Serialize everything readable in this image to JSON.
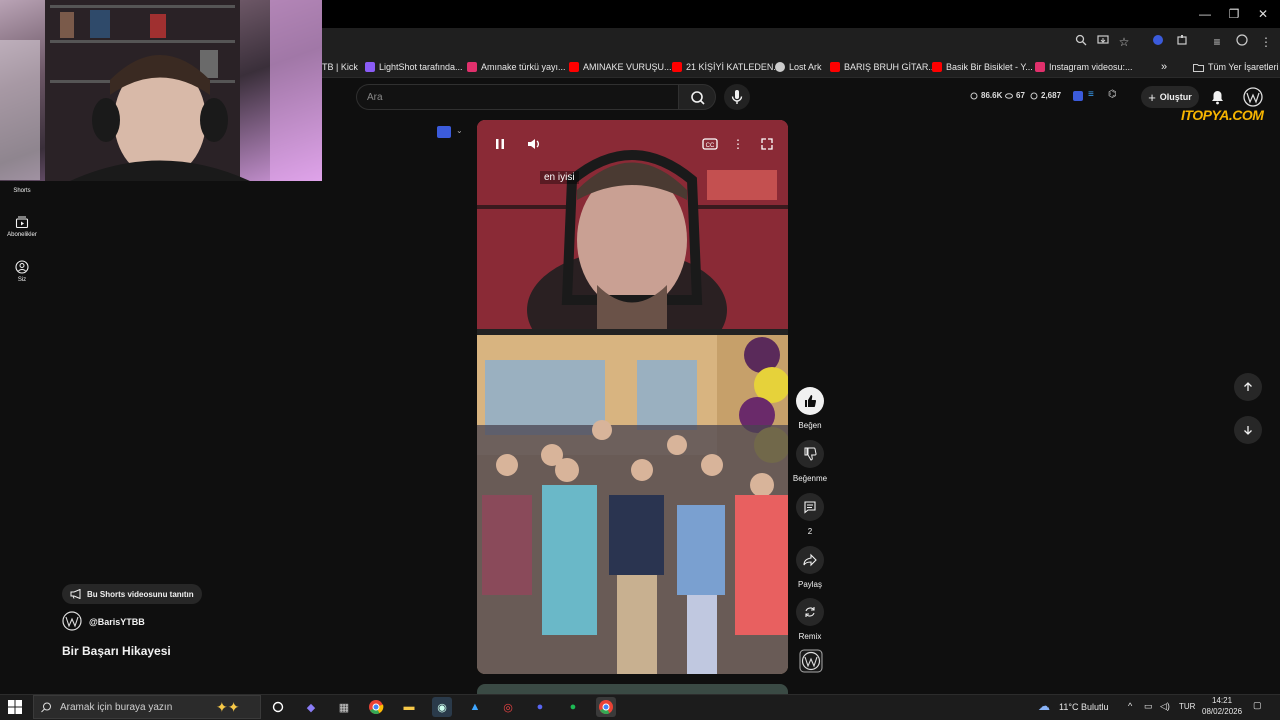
{
  "window": {
    "minimize": "—",
    "maximize": "❐",
    "close": "✕"
  },
  "bookmarks": [
    {
      "label": "TB | Kick",
      "color": "#53fc18"
    },
    {
      "label": "LightShot tarafında...",
      "color": "#8a5cf6"
    },
    {
      "label": "Amınake türkü yayı...",
      "color": "#e1306c"
    },
    {
      "label": "AMINAKE VURUŞU...",
      "color": "#ff0000"
    },
    {
      "label": "21 KİŞİYİ KATLEDEN...",
      "color": "#ff0000"
    },
    {
      "label": "Lost Ark",
      "color": "#cccccc"
    },
    {
      "label": "BARIŞ BRUH GİTAR...",
      "color": "#ff0000"
    },
    {
      "label": "Basik Bir Bisiklet - Y...",
      "color": "#ff0000"
    },
    {
      "label": "Instagram videosu:...",
      "color": "#e1306c"
    }
  ],
  "bookmarks_more": "»",
  "all_bookmarks": "Tüm Yer İşaretleri",
  "search": {
    "placeholder": "Ara"
  },
  "stats": {
    "views": "86.6K",
    "likes": "67",
    "other": "2,687"
  },
  "create_label": "Oluştur",
  "watermark": "ITOPYA.COM",
  "sidebar": [
    {
      "label": "Shorts"
    },
    {
      "label": "Abonelikler"
    },
    {
      "label": "Siz"
    }
  ],
  "video": {
    "caption": "en iyisi"
  },
  "actions": {
    "like": "Beğen",
    "dislike": "Beğenme",
    "comments": "2",
    "share": "Paylaş",
    "remix": "Remix"
  },
  "channel": {
    "promote": "Bu Shorts videosunu tanıtın",
    "handle": "@BarisYTBB",
    "title": "Bir Başarı Hikayesi"
  },
  "taskbar": {
    "search_placeholder": "Aramak için buraya yazın",
    "weather": "11°C Bulutlu",
    "lang": "TUR",
    "time": "14:21",
    "date": "08/02/2026"
  },
  "colors": {
    "accent": "#3ea6ff",
    "bg": "#0f0f0f",
    "chip": "#272727"
  }
}
